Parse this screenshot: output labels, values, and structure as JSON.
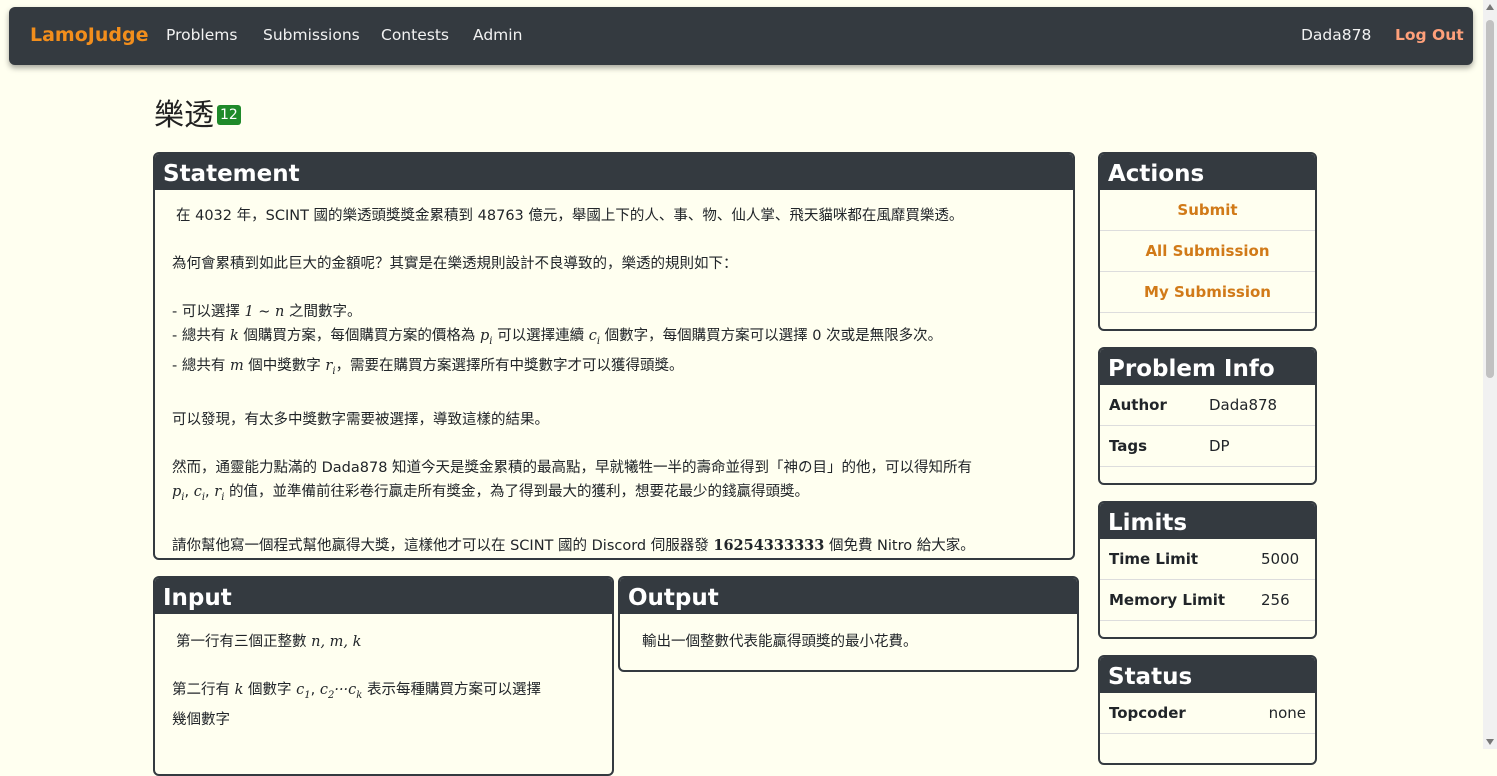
{
  "nav": {
    "brand": "LamoJudge",
    "links": [
      "Problems",
      "Submissions",
      "Contests",
      "Admin"
    ],
    "user": "Dada878",
    "logout": "Log Out"
  },
  "problem": {
    "title": "樂透",
    "badge": "12"
  },
  "statement": {
    "header": "Statement",
    "p1": "在 4032 年，SCINT 國的樂透頭獎獎金累積到 48763 億元，舉國上下的人、事、物、仙人掌、飛天貓咪都在風靡買樂透。",
    "p2": "為何會累積到如此巨大的金額呢？其實是在樂透規則設計不良導致的，樂透的規則如下：",
    "rule1_a": "- 可以選擇 ",
    "rule1_math": "1 ∼ n",
    "rule1_b": " 之間數字。",
    "rule2_a": "- 總共有 ",
    "rule2_k": "k",
    "rule2_b": " 個購買方案，每個購買方案的價格為 ",
    "rule2_p": "p",
    "rule2_c": " 可以選擇連續 ",
    "rule2_cvar": "c",
    "rule2_d": " 個數字，每個購買方案可以選擇 0 次或是無限多次。",
    "rule3_a": "- 總共有 ",
    "rule3_m": "m",
    "rule3_b": " 個中獎數字 ",
    "rule3_r": "r",
    "rule3_c": "，需要在購買方案選擇所有中獎數字才可以獲得頭獎。",
    "p4": "可以發現，有太多中獎數字需要被選擇，導致這樣的結果。",
    "p5_a": "然而，通靈能力點滿的 Dada878 知道今天是獎金累積的最高點，早就犧牲一半的壽命並得到「神の目」的他，可以得知所有",
    "p5_b": " 的值，並準備前往彩卷行贏走所有獎金，為了得到最大的獲利，想要花最少的錢贏得頭獎。",
    "p6_a": "請你幫他寫一個程式幫他贏得大獎，這樣他才可以在 SCINT 國的 Discord 伺服器發 ",
    "p6_num": "16254333333",
    "p6_b": " 個免費 Nitro 給大家。"
  },
  "input": {
    "header": "Input",
    "line1": "第一行有三個正整數 ",
    "line1_math": "n, m, k",
    "line2_a": "第二行有 ",
    "line2_k": "k",
    "line2_b": " 個數字 ",
    "line2_c": " 表示每種購買方案可以選擇",
    "line3": "幾個數字"
  },
  "output": {
    "header": "Output",
    "text": "輸出一個整數代表能贏得頭獎的最小花費。"
  },
  "actions": {
    "header": "Actions",
    "items": [
      "Submit",
      "All Submission",
      "My Submission"
    ]
  },
  "info": {
    "header": "Problem Info",
    "author_label": "Author",
    "author": "Dada878",
    "tags_label": "Tags",
    "tags": "DP"
  },
  "limits": {
    "header": "Limits",
    "time_label": "Time Limit",
    "time": "5000",
    "memory_label": "Memory Limit",
    "memory": "256"
  },
  "status": {
    "header": "Status",
    "topcoder_label": "Topcoder",
    "topcoder": "none"
  },
  "colors": {
    "navbar": "#343a40",
    "brand": "#f28e1c",
    "logout": "#ffa07a",
    "link": "#d17a18",
    "badge": "#1f8a2a",
    "background": "#fffff0"
  }
}
